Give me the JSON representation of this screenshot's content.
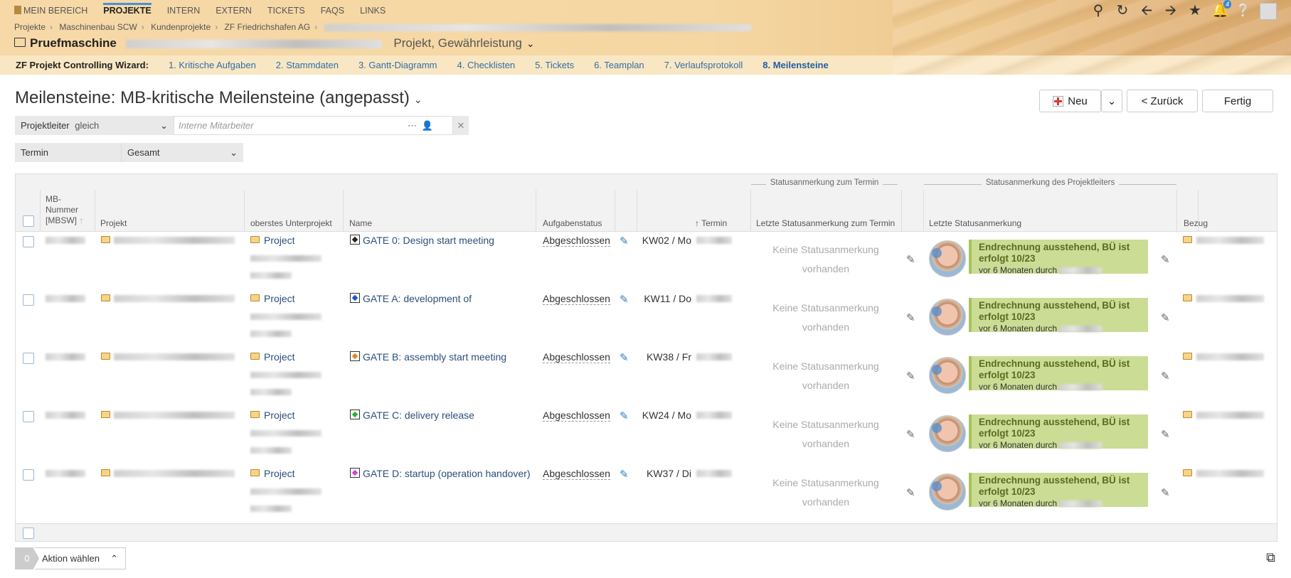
{
  "nav": {
    "items": [
      "MEIN BEREICH",
      "PROJEKTE",
      "INTERN",
      "EXTERN",
      "TICKETS",
      "FAQS",
      "LINKS"
    ],
    "active_index": 1,
    "notification_count": "4"
  },
  "breadcrumb": [
    "Projekte",
    "Maschinenbau SCW",
    "Kundenprojekte",
    "ZF Friedrichshafen AG"
  ],
  "project": {
    "name": "Pruefmaschine",
    "subtitle": "Projekt, Gewährleistung"
  },
  "wizard": {
    "label": "ZF Projekt Controlling Wizard:",
    "steps": [
      "1. Kritische Aufgaben",
      "2. Stammdaten",
      "3. Gantt-Diagramm",
      "4. Checklisten",
      "5. Tickets",
      "6. Teamplan",
      "7. Verlaufsprotokoll",
      "8. Meilensteine"
    ],
    "active_index": 7
  },
  "page_title": "Meilensteine: MB-kritische Meilensteine (angepasst)",
  "buttons": {
    "new": "Neu",
    "back": "< Zurück",
    "done": "Fertig"
  },
  "filters": {
    "projektleiter_label": "Projektleiter",
    "projektleiter_op": "gleich",
    "projektleiter_placeholder": "Interne Mitarbeiter",
    "termin_label": "Termin",
    "termin_value": "Gesamt"
  },
  "table": {
    "group_headers": [
      "Statusanmerkung zum Termin",
      "Statusanmerkung des Projektleiters"
    ],
    "columns": {
      "mbnr": "MB-Nummer [MBSW]",
      "projekt": "Projekt",
      "unterprojekt": "oberstes Unterprojekt",
      "name": "Name",
      "status": "Aufgabenstatus",
      "termin": "Termin",
      "letzte_termin": "Letzte Statusanmerkung zum Termin",
      "letzte": "Letzte Statusanmerkung",
      "bezug": "Bezug"
    },
    "rows": [
      {
        "unterprojekt": "Project",
        "name": "GATE 0: Design start meeting",
        "gate_color": "#222",
        "status": "Abgeschlossen",
        "termin": "KW02 / Mo",
        "no_status": "Keine Statusanmerkung vorhanden",
        "note_title": "Endrechnung ausstehend, BÜ ist erfolgt 10/23",
        "note_sub": "vor 6 Monaten durch"
      },
      {
        "unterprojekt": "Project",
        "name": "GATE A: development of",
        "gate_color": "#1c4fd6",
        "status": "Abgeschlossen",
        "termin": "KW11 / Do",
        "no_status": "Keine Statusanmerkung vorhanden",
        "note_title": "Endrechnung ausstehend, BÜ ist erfolgt 10/23",
        "note_sub": "vor 6 Monaten durch"
      },
      {
        "unterprojekt": "Project",
        "name": "GATE B: assembly start meeting",
        "gate_color": "#e8841a",
        "status": "Abgeschlossen",
        "termin": "KW38 / Fr",
        "no_status": "Keine Statusanmerkung vorhanden",
        "note_title": "Endrechnung ausstehend, BÜ ist erfolgt 10/23",
        "note_sub": "vor 6 Monaten durch"
      },
      {
        "unterprojekt": "Project",
        "name": "GATE C: delivery release",
        "gate_color": "#2fae3a",
        "status": "Abgeschlossen",
        "termin": "KW24 / Mo",
        "no_status": "Keine Statusanmerkung vorhanden",
        "note_title": "Endrechnung ausstehend, BÜ ist erfolgt 10/23",
        "note_sub": "vor 6 Monaten durch"
      },
      {
        "unterprojekt": "Project",
        "name": "GATE D: startup (operation handover)",
        "gate_color": "#d63fd6",
        "status": "Abgeschlossen",
        "termin": "KW37 / Di",
        "no_status": "Keine Statusanmerkung vorhanden",
        "note_title": "Endrechnung ausstehend, BÜ ist erfolgt 10/23",
        "note_sub": "vor 6 Monaten durch"
      }
    ]
  },
  "action": {
    "count": "0",
    "label": "Aktion wählen"
  }
}
